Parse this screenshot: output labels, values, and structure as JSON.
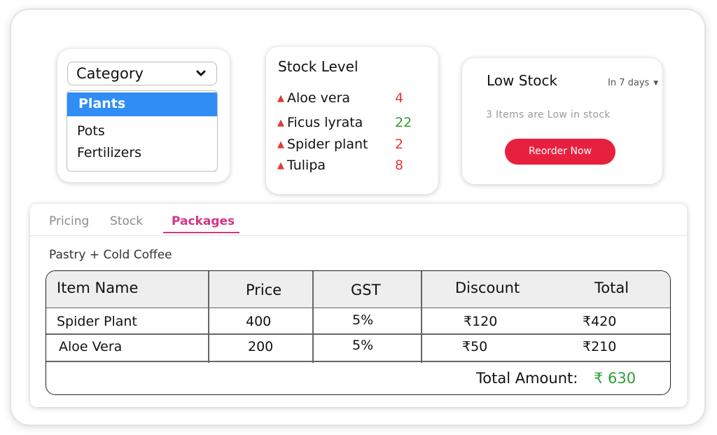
{
  "category": {
    "label": "Category",
    "options": [
      "Plants",
      "Pots",
      "Fertilizers"
    ],
    "selected": "Plants"
  },
  "stock_level": {
    "title": "Stock Level",
    "items": [
      {
        "name": "Aloe vera",
        "value": "4",
        "color": "#e53935"
      },
      {
        "name": "Ficus lyrata",
        "value": "22",
        "color": "#2e9e3a"
      },
      {
        "name": "Spider plant",
        "value": "2",
        "color": "#e53935"
      },
      {
        "name": "Tulipa",
        "value": "8",
        "color": "#e53935"
      }
    ]
  },
  "low_stock": {
    "title": "Low Stock",
    "period": "In 7 days",
    "message": "3 Items are Low in stock",
    "button": "Reorder Now"
  },
  "tabs": [
    "Pricing",
    "Stock",
    "Packages"
  ],
  "active_tab": "Packages",
  "package": {
    "title": "Pastry + Cold Coffee",
    "columns": [
      "Item Name",
      "Price",
      "GST",
      "Discount",
      "Total"
    ],
    "rows": [
      {
        "name": "Spider Plant",
        "price": "400",
        "gst": "5%",
        "discount": "₹120",
        "total": "₹420"
      },
      {
        "name": "Aloe Vera",
        "price": "200",
        "gst": "5%",
        "discount": "₹50",
        "total": "₹210"
      }
    ],
    "total_label": "Total Amount:",
    "total_value": "₹ 630"
  }
}
